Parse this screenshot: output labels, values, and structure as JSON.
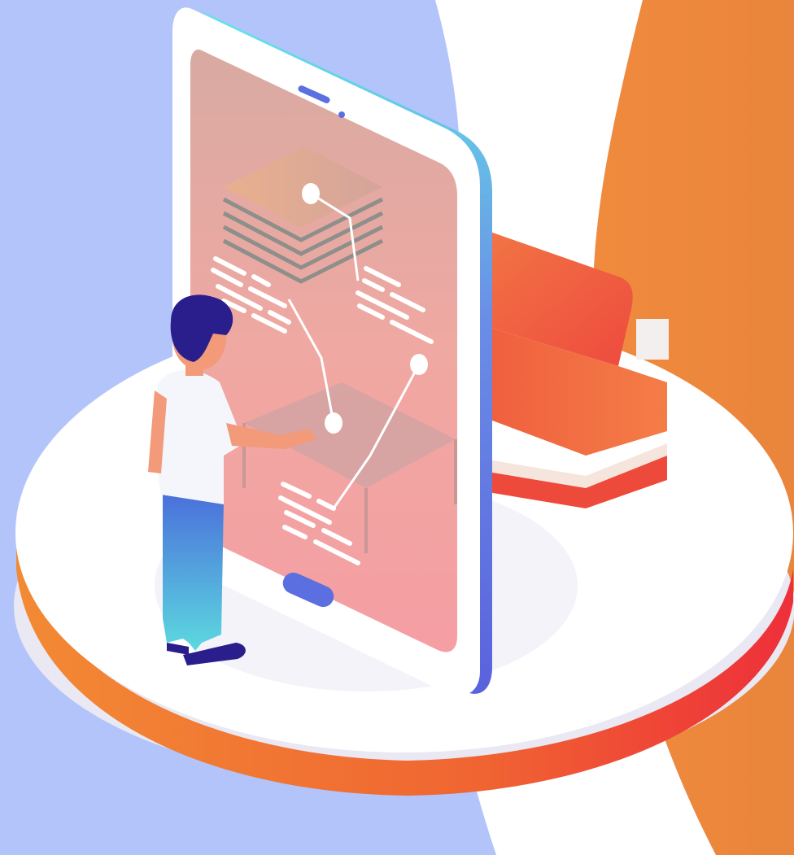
{
  "scene": {
    "description_free": true,
    "colors": {
      "background_blue": "#b3c4fb",
      "background_white": "#ffffff",
      "background_orange": "#ee873f",
      "platform_top": "#ffffff",
      "platform_side_light": "#ecebf5",
      "platform_stripe_orange": "#f07a33",
      "platform_stripe_red": "#ee3b3b",
      "phone_frame_white": "#ffffff",
      "phone_edge_cyan": "#5ee3e8",
      "phone_edge_blue": "#5b6fe0",
      "phone_screen_top": "#d8a79f",
      "phone_screen_bottom": "#f6a0a3",
      "sofa_orange": "#f37246",
      "sofa_red": "#ee3e39",
      "sofa_base_light": "#f6e5dd",
      "person_hair": "#2a1e8c",
      "person_shirt": "#f4f6fb",
      "person_skin": "#f39a7a",
      "person_pants_top": "#4a6fdb",
      "person_pants_bottom": "#5ed6e0",
      "person_shoes": "#2a1e8c",
      "connector_white": "#ffffff"
    },
    "icons": [
      "smartphone-icon",
      "sofa-icon",
      "person-icon",
      "stacked-layers-icon",
      "connector-node-icon"
    ]
  }
}
